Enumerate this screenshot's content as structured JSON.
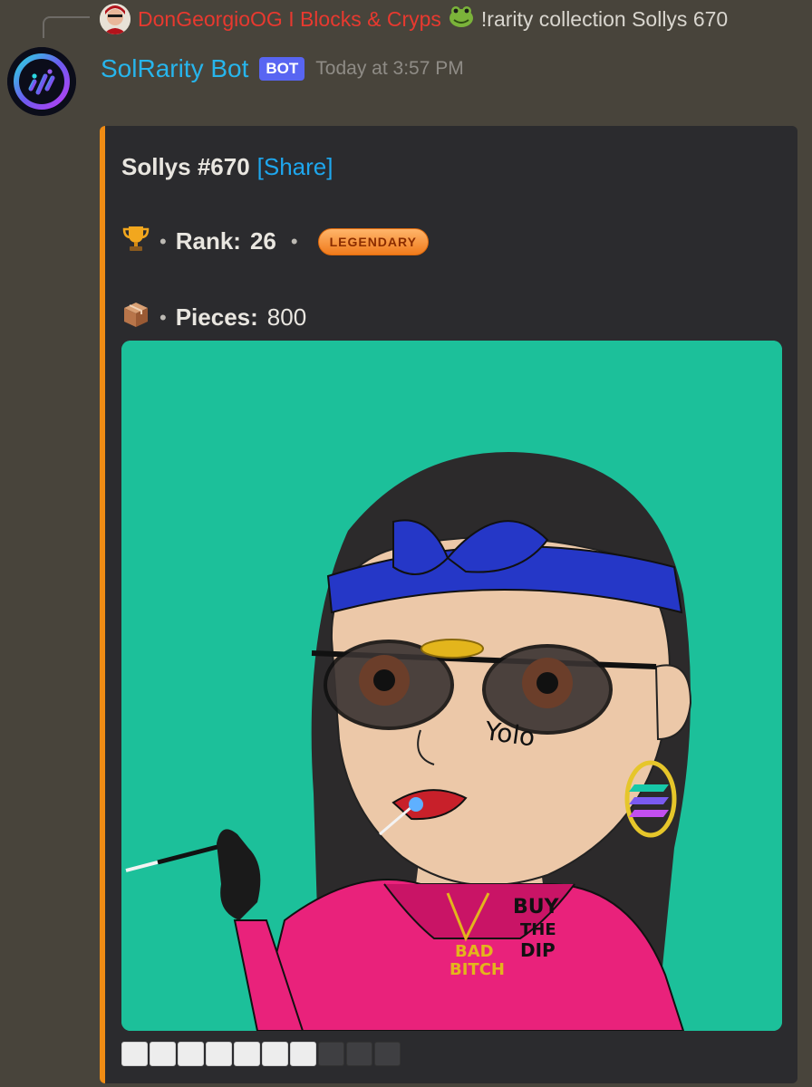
{
  "reply": {
    "author": "DonGeorgioOG I Blocks & Cryps",
    "emoji_icon": "frog-icon",
    "content": "!rarity collection Sollys 670"
  },
  "message": {
    "author": "SolRarity Bot",
    "tag": "BOT",
    "timestamp": "Today at 3:57 PM"
  },
  "embed": {
    "accent_color": "#f08c14",
    "title": "Sollys #670",
    "share_link": "[Share]",
    "rank_icon": "trophy-icon",
    "rank_label": "Rank:",
    "rank_value": "26",
    "rarity_badge": "LEGENDARY",
    "pieces_icon": "package-icon",
    "pieces_label": "Pieces:",
    "pieces_value": "800",
    "image_text": {
      "cheek": "Yolo",
      "hoodie_line1": "BUY",
      "hoodie_line2": "THE",
      "hoodie_line3": "DIP",
      "chain_line1": "BAD",
      "chain_line2": "BITCH"
    },
    "rarity_bar": {
      "filled": 7,
      "total": 10
    }
  }
}
